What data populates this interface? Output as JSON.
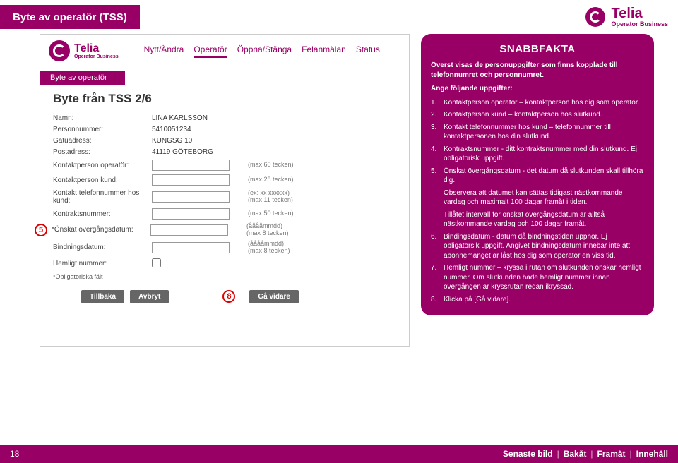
{
  "header": {
    "title": "Byte av operatör (TSS)",
    "brand": "Telia",
    "brand_sub": "Operator Business"
  },
  "app": {
    "brand": "Telia",
    "brand_sub": "Operator Business",
    "tabs": [
      "Nytt/Ändra",
      "Operatör",
      "Öppna/Stänga",
      "Felanmälan",
      "Status"
    ],
    "active_tab": 1,
    "breadcrumb": "Byte av operatör",
    "page_title": "Byte från TSS 2/6",
    "fields": {
      "namn_label": "Namn:",
      "namn_value": "LINA KARLSSON",
      "personnr_label": "Personnummer:",
      "personnr_value": "5410051234",
      "gatu_label": "Gatuadress:",
      "gatu_value": "KUNGSG 10",
      "post_label": "Postadress:",
      "post_value": "41119 GÖTEBORG",
      "kontakt_op_label": "Kontaktperson operatör:",
      "kontakt_op_hint": "(max 60 tecken)",
      "kontakt_kund_label": "Kontaktperson kund:",
      "kontakt_kund_hint": "(max 28 tecken)",
      "ktel_label": "Kontakt telefonnummer hos kund:",
      "ktel_hint1": "(ex: xx xxxxxx)",
      "ktel_hint2": "(max 11 tecken)",
      "kontrakt_label": "Kontraktsnummer:",
      "kontrakt_hint": "(max 50 tecken)",
      "overgang_label": "*Önskat övergångsdatum:",
      "overgang_hint1": "(ååååmmdd)",
      "overgang_hint2": "(max 8 tecken)",
      "bind_label": "Bindningsdatum:",
      "bind_hint1": "(ååååmmdd)",
      "bind_hint2": "(max 8 tecken)",
      "hemligt_label": "Hemligt nummer:",
      "footnote": "*Obligatoriska fält"
    },
    "buttons": {
      "back": "Tillbaka",
      "cancel": "Avbryt",
      "next": "Gå vidare"
    },
    "callouts": {
      "c5": "5",
      "c8": "8"
    }
  },
  "info": {
    "title": "SNABBFAKTA",
    "intro": "Överst visas de personuppgifter som finns kopplade till telefonnumret och personnumret.",
    "sub": "Ange följande uppgifter:",
    "items": [
      {
        "n": "1.",
        "t": "Kontaktperson operatör – kontaktperson hos dig som operatör."
      },
      {
        "n": "2.",
        "t": "Kontaktperson kund – kontaktperson hos slutkund."
      },
      {
        "n": "3.",
        "t": "Kontakt telefonnummer hos kund – telefonnummer till kontaktpersonen hos din slutkund."
      },
      {
        "n": "4.",
        "t": "Kontraktsnummer - ditt kontraktsnummer med din slutkund. Ej obligatorisk uppgift."
      },
      {
        "n": "5.",
        "t": "Önskat övergångsdatum - det datum då slutkunden skall tillhöra dig."
      },
      {
        "n": "",
        "t": "Observera att datumet kan sättas tidigast nästkommande vardag och maximalt 100 dagar framåt i tiden."
      },
      {
        "n": "",
        "t": "Tillåtet intervall för önskat övergångsdatum är alltså nästkommande vardag och 100 dagar framåt."
      },
      {
        "n": "6.",
        "t": "Bindingsdatum - datum då bindningstiden upphör. Ej obligatorsik uppgift. Angivet bindningsdatum innebär inte att abonnemanget är låst hos dig som operatör en viss tid."
      },
      {
        "n": "7.",
        "t": "Hemligt nummer – kryssa i rutan om slutkunden önskar hemligt nummer. Om slutkunden hade hemligt nummer innan övergången är kryssrutan redan ikryssad."
      },
      {
        "n": "8.",
        "t": "Klicka på [Gå vidare]."
      }
    ]
  },
  "footer": {
    "page": "18",
    "nav": [
      "Senaste bild",
      "Bakåt",
      "Framåt",
      "Innehåll"
    ]
  }
}
